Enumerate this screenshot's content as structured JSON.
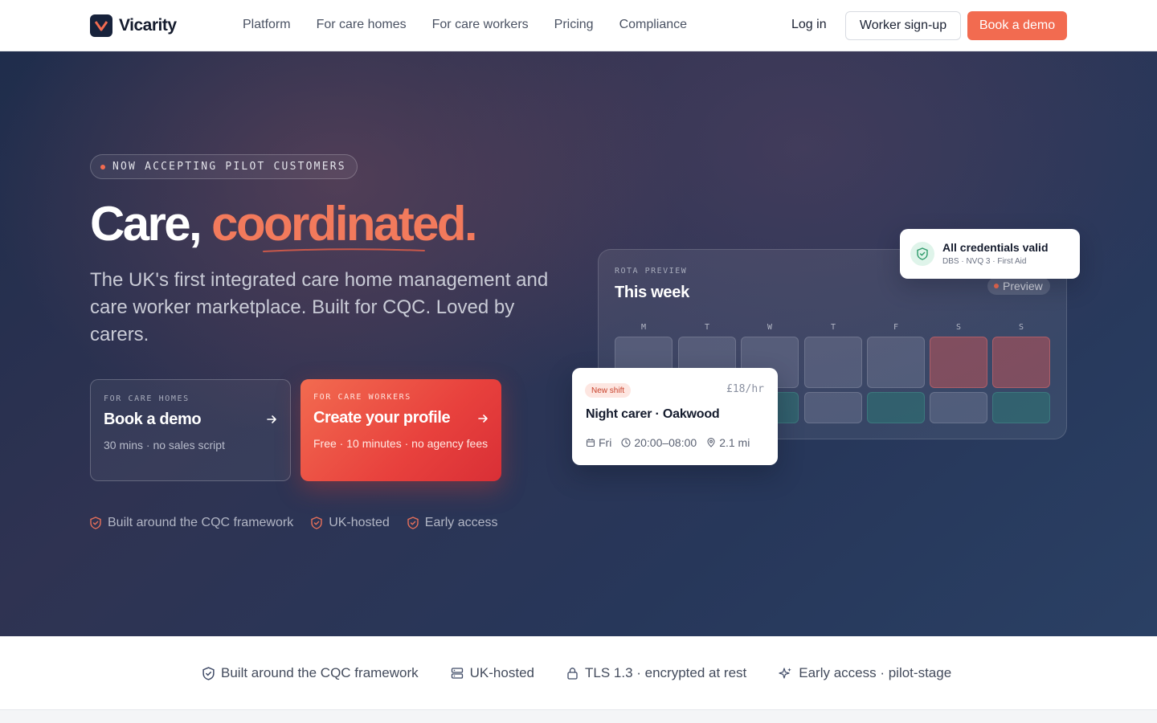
{
  "nav": {
    "brand": "Vicarity",
    "links": [
      "Platform",
      "For care homes",
      "For care workers",
      "Pricing",
      "Compliance"
    ],
    "login": "Log in",
    "worker_signup": "Worker sign-up",
    "book_demo": "Book a demo"
  },
  "hero": {
    "pill": "NOW ACCEPTING PILOT CUSTOMERS",
    "headline_plain": "Care, ",
    "headline_accent": "coordinated.",
    "subtitle": "The UK's first integrated care home management and care worker marketplace. Built for CQC. Loved by carers.",
    "cta_homes": {
      "eyebrow": "FOR CARE HOMES",
      "title": "Book a demo",
      "sub": "30 mins · no sales script"
    },
    "cta_workers": {
      "eyebrow": "FOR CARE WORKERS",
      "title": "Create your profile",
      "sub": "Free · 10 minutes · no agency fees"
    },
    "trust": [
      "Built around the CQC framework",
      "UK-hosted",
      "Early access"
    ]
  },
  "rota": {
    "eyebrow": "ROTA PREVIEW",
    "title": "This week",
    "preview": "Preview",
    "days": [
      "M",
      "T",
      "W",
      "T",
      "F",
      "S",
      "S"
    ]
  },
  "credentials": {
    "title": "All credentials valid",
    "sub": "DBS · NVQ 3 · First Aid"
  },
  "shift": {
    "badge": "New shift",
    "rate": "£18/hr",
    "title": "Night carer · Oakwood",
    "day": "Fri",
    "time": "20:00–08:00",
    "distance": "2.1 mi"
  },
  "strip": [
    "Built around the CQC framework",
    "UK-hosted",
    "TLS 1.3 · encrypted at rest",
    "Early access · pilot-stage"
  ],
  "colors": {
    "accent": "#f26b50",
    "navy": "#17223b",
    "success": "#2e9b6b"
  }
}
